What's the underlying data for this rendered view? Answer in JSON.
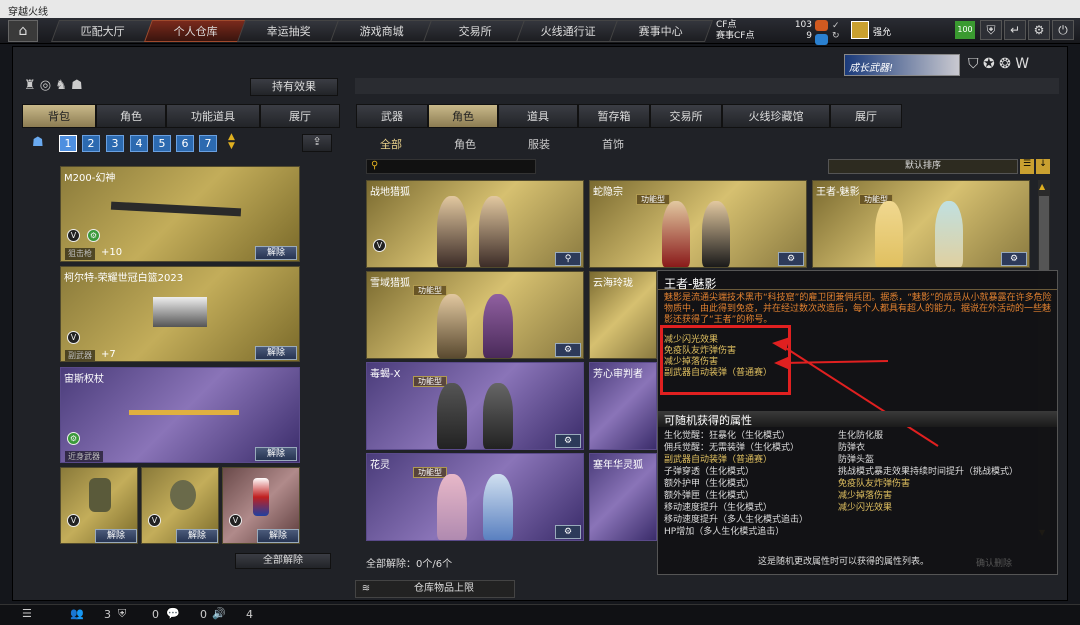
{
  "window": {
    "title": "穿越火线"
  },
  "nav": {
    "tabs": [
      "匹配大厅",
      "个人仓库",
      "幸运抽奖",
      "游戏商城",
      "交易所",
      "火线通行证",
      "赛事中心"
    ],
    "active": 1,
    "cf_label": "CF点",
    "cf_value": "103",
    "match_label": "赛事CF点",
    "match_value": "9",
    "username": "强允",
    "level": "100"
  },
  "left": {
    "effect_btn": "持有效果",
    "tabs": [
      "背包",
      "角色",
      "功能道具",
      "展厅"
    ],
    "pages": [
      "1",
      "2",
      "3",
      "4",
      "5",
      "6",
      "7"
    ],
    "items": [
      {
        "name": "M200-幻神",
        "slot": "狙击枪",
        "count": "+10",
        "btn": "解除"
      },
      {
        "name": "柯尔特-荣耀世冠白篮2023",
        "slot": "副武器",
        "count": "+7",
        "btn": "解除"
      },
      {
        "name": "宙斯权杖",
        "slot": "近身武器",
        "btn": "解除"
      }
    ],
    "grenade_btn": "解除",
    "unequip_all": "全部解除"
  },
  "right": {
    "tabs": [
      "武器",
      "角色",
      "道具",
      "暂存箱",
      "交易所",
      "火线珍藏馆",
      "展厅"
    ],
    "subtabs": [
      "全部",
      "角色",
      "服装",
      "首饰"
    ],
    "sort": "默认排序",
    "func_tag": "功能型",
    "cards": [
      "战地猎狐",
      "蛇隐宗",
      "王者-魅影",
      "雪域猎狐",
      "云海玲珑",
      "毒蝎-X",
      "芳心审判者",
      "花灵",
      "塞年华灵狐"
    ],
    "footer": "全部解除：0个/6个",
    "storage": "仓库物品上限"
  },
  "tooltip": {
    "title": "王者-魅影",
    "desc": "魅影是流通尖端技术黑市“科技窟”的雇卫团兼佣兵团。据悉，“魅影”的成员从小就暴露在许多危险物质中，由此得到免疫，并在经过数次改造后，每个人都具有超人的能力。据说在外活动的一些魅影还获得了“王者”的称号。",
    "effects": [
      "减少闪光效果",
      "免疫队友炸弹伤害",
      "减少掉落伤害",
      "副武器自动装弹（普通赛）"
    ],
    "random_title": "可随机获得的属性",
    "random_left": [
      "生化觉醒：狂暴化（生化模式）",
      "佣兵觉醒：无需装弹（生化模式）",
      "副武器自动装弹（普通赛）",
      "子弹穿透（生化模式）",
      "额外护甲（生化模式）",
      "额外弹匣（生化模式）",
      "移动速度提升（生化模式）",
      "移动速度提升（多人生化模式追击）",
      "HP增加（多人生化模式追击）"
    ],
    "random_right": [
      "生化防化服",
      "防弹衣",
      "防弹头盔",
      "挑战模式暴走效果持续时间提升（挑战模式）",
      "免疫队友炸弹伤害",
      "减少掉落伤害",
      "减少闪光效果"
    ],
    "footer_note": "这是随机更改属性时可以获得的属性列表。",
    "hidden_btn": "确认删除"
  },
  "status": {
    "a": "3",
    "b": "0",
    "c": "0",
    "d": "4"
  },
  "banner": "成长武器!"
}
